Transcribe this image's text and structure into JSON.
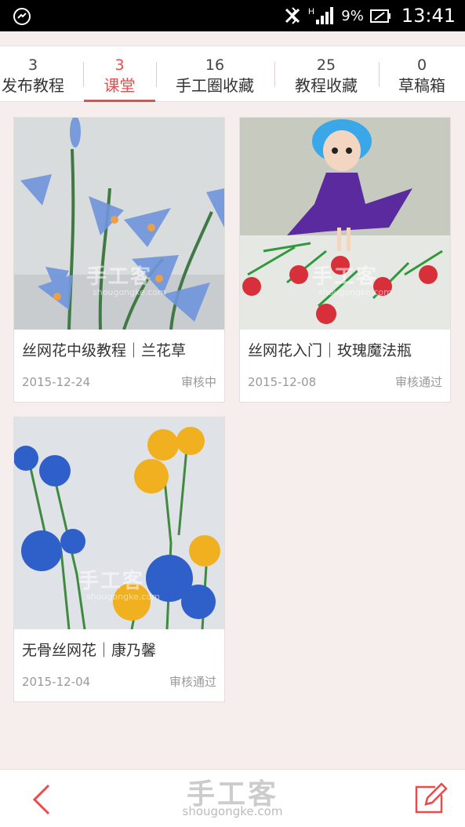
{
  "status_bar": {
    "left_icon": "no-disturb-icon",
    "icons": [
      "bluetooth-off-icon",
      "signal-icon",
      "battery-icon"
    ],
    "network": "H",
    "battery": "9%",
    "time": "13:41"
  },
  "tabs": [
    {
      "count": "3",
      "label": "发布教程",
      "active": false
    },
    {
      "count": "3",
      "label": "课堂",
      "active": true
    },
    {
      "count": "16",
      "label": "手工圈收藏",
      "active": false
    },
    {
      "count": "25",
      "label": "教程收藏",
      "active": false
    },
    {
      "count": "0",
      "label": "草稿箱",
      "active": false
    }
  ],
  "cards": [
    {
      "title": "丝网花中级教程｜兰花草",
      "date": "2015-12-24",
      "status": "审核中",
      "image": "blue-orchid-photo"
    },
    {
      "title": "丝网花入门｜玫瑰魔法瓶",
      "date": "2015-12-08",
      "status": "审核通过",
      "image": "doll-and-roses-photo"
    },
    {
      "title": "无骨丝网花｜康乃馨",
      "date": "2015-12-04",
      "status": "审核通过",
      "image": "carnation-photo"
    }
  ],
  "watermark": {
    "main": "手工客",
    "sub": "shougongke.com"
  },
  "bottom_bar": {
    "logo_main": "手工客",
    "logo_sub": "shougongke.com",
    "back_icon": "back-chevron-icon",
    "edit_icon": "edit-icon"
  },
  "colors": {
    "accent": "#e84c4c",
    "background": "#f6eeed"
  }
}
